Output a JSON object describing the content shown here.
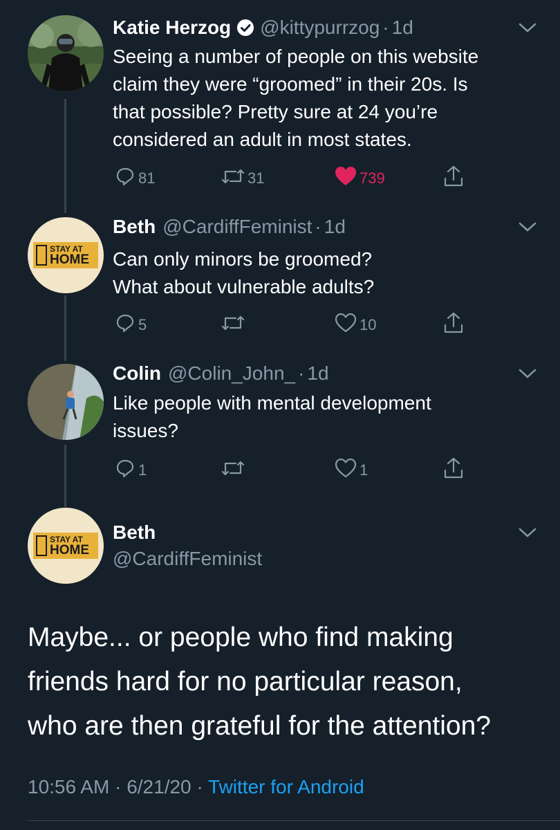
{
  "tweets": [
    {
      "name": "Katie Herzog",
      "handle": "@kittypurrzog",
      "time": "1d",
      "verified": true,
      "lines": [
        "Seeing a number of people on this website",
        "claim they were “groomed” in their 20s. Is",
        "that possible? Pretty sure at 24 you’re",
        "considered an adult in most states."
      ],
      "replies": "81",
      "retweets": "31",
      "likes": "739",
      "liked": true
    },
    {
      "name": "Beth",
      "handle": "@CardiffFeminist",
      "time": "1d",
      "lines": [
        "Can only minors be groomed?",
        "What about vulnerable adults?"
      ],
      "replies": "5",
      "retweets": "",
      "likes": "10"
    },
    {
      "name": "Colin",
      "handle": "@Colin_John_",
      "time": "1d",
      "lines": [
        "Like people with mental development",
        "issues?"
      ],
      "replies": "1",
      "retweets": "",
      "likes": "1"
    }
  ],
  "main": {
    "name": "Beth",
    "handle": "@CardiffFeminist",
    "lines": [
      "Maybe... or people who find making",
      "friends hard for no particular reason,",
      "who are then grateful for the attention?"
    ],
    "time": "10:56 AM",
    "date": "6/21/20",
    "source": "Twitter for Android"
  },
  "avatar_badge": {
    "line1": "STAY AT",
    "line2": "HOME"
  },
  "colors": {
    "background": "#15202b",
    "secondary_text": "#8899a6",
    "like_red": "#e0245e",
    "link_blue": "#1da1f2",
    "badge_yellow": "#e8b23a"
  }
}
